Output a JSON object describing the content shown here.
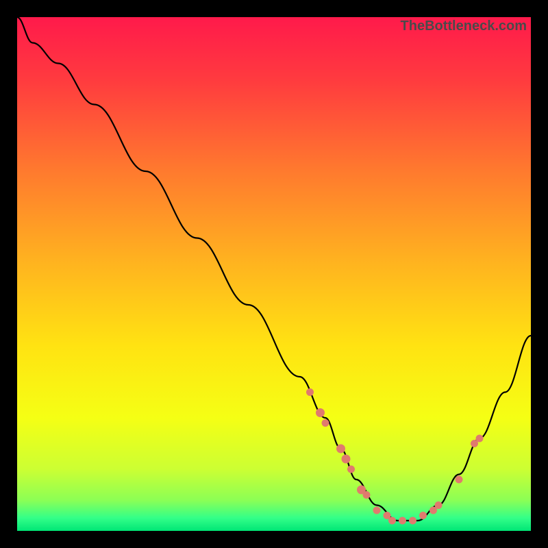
{
  "watermark": "TheBottleneck.com",
  "gradient": {
    "stops": [
      {
        "offset": 0.0,
        "color": "#ff1a4b"
      },
      {
        "offset": 0.12,
        "color": "#ff3a3f"
      },
      {
        "offset": 0.3,
        "color": "#ff7a2e"
      },
      {
        "offset": 0.48,
        "color": "#ffb41f"
      },
      {
        "offset": 0.64,
        "color": "#ffe312"
      },
      {
        "offset": 0.78,
        "color": "#f5ff14"
      },
      {
        "offset": 0.88,
        "color": "#ccff33"
      },
      {
        "offset": 0.94,
        "color": "#8cff55"
      },
      {
        "offset": 0.975,
        "color": "#33ff88"
      },
      {
        "offset": 1.0,
        "color": "#00e676"
      }
    ]
  },
  "colors": {
    "curve": "#000000",
    "marker_fill": "#e07a6e",
    "marker_stroke": "#e07a6e"
  },
  "chart_data": {
    "type": "line",
    "title": "",
    "xlabel": "",
    "ylabel": "",
    "xlim": [
      0,
      100
    ],
    "ylim": [
      0,
      100
    ],
    "grid": false,
    "series": [
      {
        "name": "bottleneck-curve",
        "x": [
          0,
          3,
          8,
          15,
          25,
          35,
          45,
          55,
          60,
          63,
          66,
          70,
          74,
          78,
          82,
          86,
          90,
          95,
          100
        ],
        "y": [
          100,
          95,
          91,
          83,
          70,
          57,
          44,
          30,
          22,
          16,
          10,
          5,
          2,
          2,
          5,
          11,
          18,
          27,
          38
        ]
      }
    ],
    "markers": {
      "name": "highlight-points",
      "color": "#e07a6e",
      "points": [
        {
          "x": 57,
          "y": 27,
          "r": 5
        },
        {
          "x": 59,
          "y": 23,
          "r": 6
        },
        {
          "x": 60,
          "y": 21,
          "r": 5
        },
        {
          "x": 63,
          "y": 16,
          "r": 6
        },
        {
          "x": 64,
          "y": 14,
          "r": 6
        },
        {
          "x": 65,
          "y": 12,
          "r": 5
        },
        {
          "x": 67,
          "y": 8,
          "r": 6
        },
        {
          "x": 68,
          "y": 7,
          "r": 5
        },
        {
          "x": 70,
          "y": 4,
          "r": 5
        },
        {
          "x": 72,
          "y": 3,
          "r": 5
        },
        {
          "x": 73,
          "y": 2,
          "r": 5
        },
        {
          "x": 75,
          "y": 2,
          "r": 5
        },
        {
          "x": 77,
          "y": 2,
          "r": 5
        },
        {
          "x": 79,
          "y": 3,
          "r": 5
        },
        {
          "x": 81,
          "y": 4,
          "r": 5
        },
        {
          "x": 82,
          "y": 5,
          "r": 5
        },
        {
          "x": 86,
          "y": 10,
          "r": 5
        },
        {
          "x": 89,
          "y": 17,
          "r": 5
        },
        {
          "x": 90,
          "y": 18,
          "r": 5
        }
      ]
    }
  }
}
